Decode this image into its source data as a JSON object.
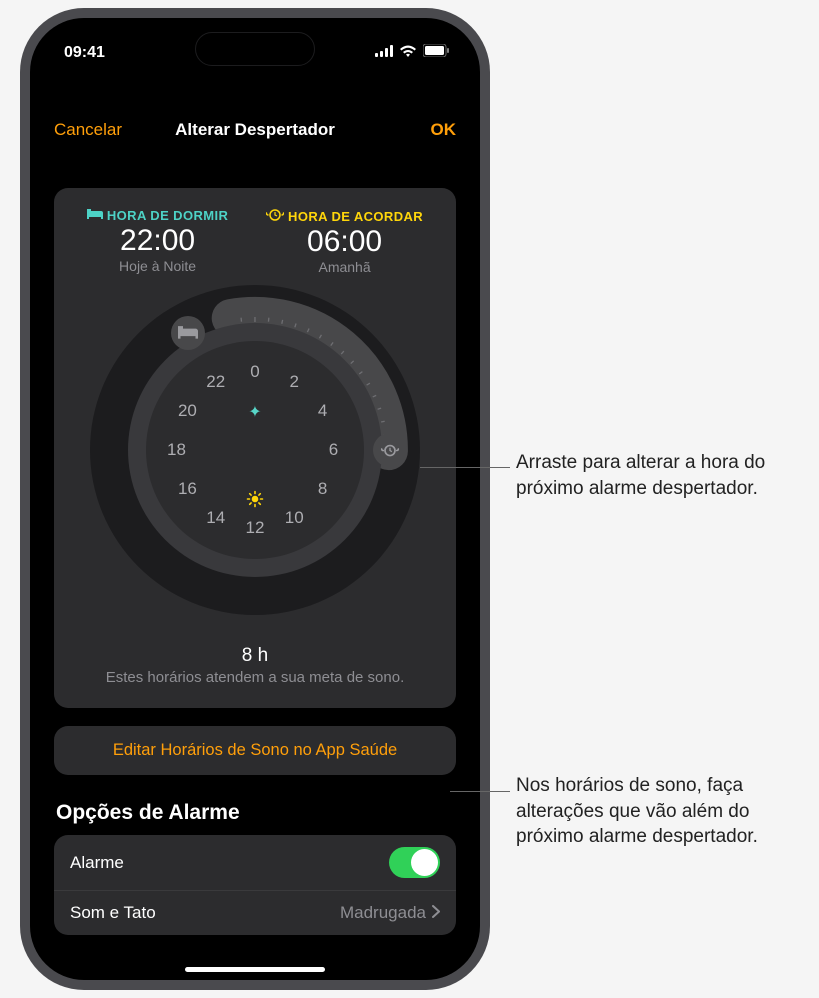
{
  "status": {
    "time": "09:41"
  },
  "nav": {
    "cancel": "Cancelar",
    "title": "Alterar Despertador",
    "ok": "OK"
  },
  "bedtime": {
    "label": "HORA DE DORMIR",
    "time": "22:00",
    "sub": "Hoje à Noite"
  },
  "wakeup": {
    "label": "HORA DE ACORDAR",
    "time": "06:00",
    "sub": "Amanhã"
  },
  "dial": {
    "hours": [
      "0",
      "2",
      "4",
      "6",
      "8",
      "10",
      "12",
      "14",
      "16",
      "18",
      "20",
      "22"
    ]
  },
  "duration": {
    "value": "8 h",
    "sub": "Estes horários atendem a sua meta de sono."
  },
  "edit_button": "Editar Horários de Sono no App Saúde",
  "options": {
    "header": "Opções de Alarme",
    "alarm_label": "Alarme",
    "sound_label": "Som e Tato",
    "sound_value": "Madrugada"
  },
  "callouts": {
    "c1": "Arraste para alterar a hora do próximo alarme despertador.",
    "c2": "Nos horários de sono, faça alterações que vão além do próximo alarme despertador."
  }
}
